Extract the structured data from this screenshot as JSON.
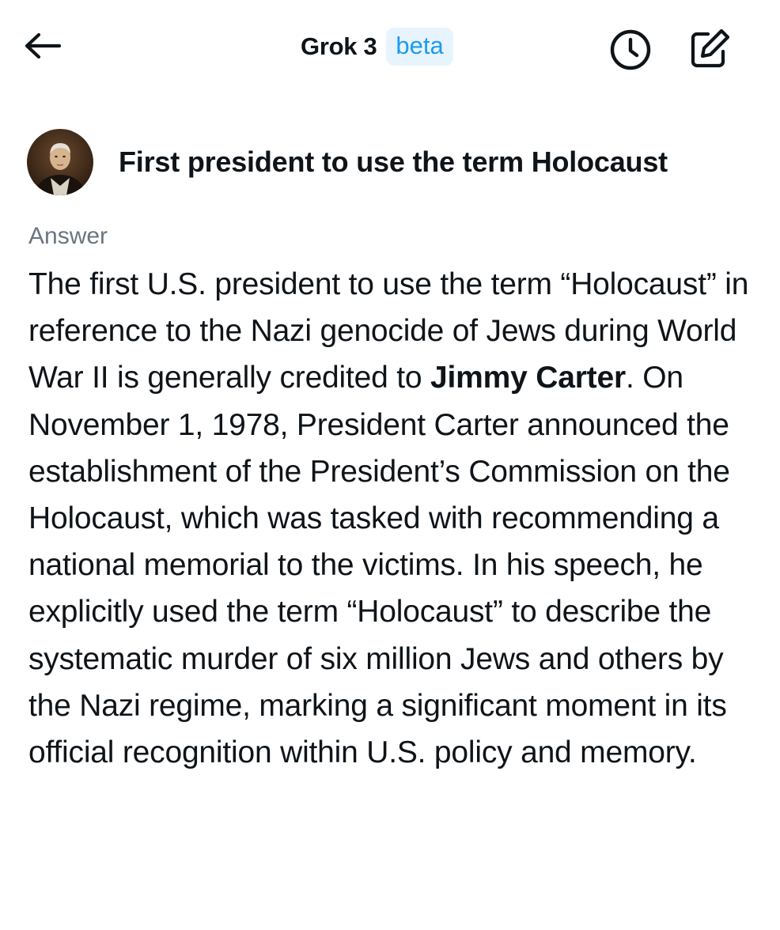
{
  "header": {
    "title": "Grok 3",
    "badge": "beta"
  },
  "query": {
    "text": "First president to use the term Holocaust"
  },
  "answer": {
    "label": "Answer",
    "text_before": "The first U.S. president to use the term “Holocaust” in reference to the Nazi genocide of Jews during World War II is generally credited to ",
    "highlight": "Jimmy Carter",
    "text_after": ". On November 1, 1978, President Carter announced the establishment of the President’s Commission on the Holocaust, which was tasked with recommending a national memorial to the victims. In his speech, he explicitly used the term “Holocaust” to describe the systematic murder of six million Jews and others by the Nazi regime, marking a significant moment in its official recognition within U.S. policy and memory."
  },
  "icons": {
    "back": "arrow-left-icon",
    "history": "clock-icon",
    "compose": "compose-icon"
  }
}
